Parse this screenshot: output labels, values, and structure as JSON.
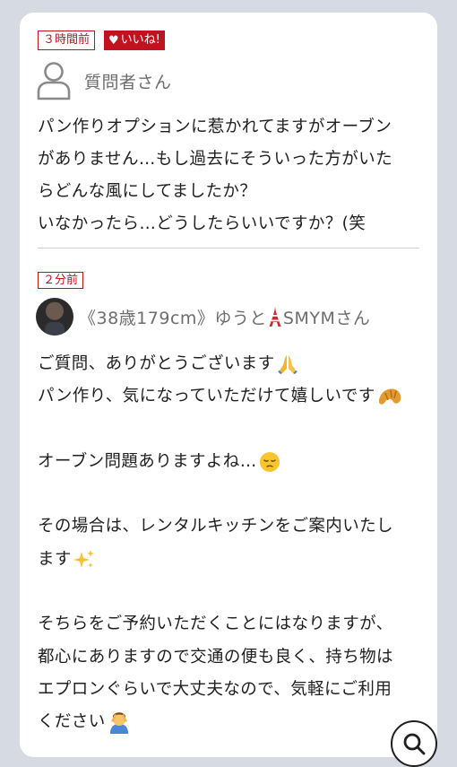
{
  "question": {
    "time_badge": "３時間前",
    "like_badge": "いいね!",
    "username": "質問者さん",
    "text": "パン作りオプションに惹かれてますがオーブン\nがありません…もし過去にそういった方がいた\nらどんな風にしてましたか？\nいなかったら…どうしたらいいですか？(笑"
  },
  "answer": {
    "time_badge": "２分前",
    "username_before": "《38歳179cm》ゆうと",
    "username_after": "SMYMさん",
    "lines": [
      "ご質問、ありがとうございます",
      "パン作り、気になっていただけて嬉しいです",
      "",
      "オーブン問題ありますよね…",
      "",
      "その場合は、レンタルキッチンをご案内いたし",
      "ます",
      "",
      "そちらをご予約いただくことにはなりますが、",
      "都心にありますので交通の便も良く、持ち物は",
      "エプロンぐらいで大丈夫なので、気軽にご利用",
      "ください"
    ]
  },
  "icons": {
    "question_avatar": "person-outline-icon",
    "tower": "tokyo-tower-icon",
    "pray": "folded-hands-emoji",
    "croissant": "croissant-emoji",
    "pensive": "pensive-face-emoji",
    "sparkles": "sparkles-emoji",
    "bowing": "person-bowing-emoji",
    "search": "search-icon"
  },
  "colors": {
    "accent": "#c1121f",
    "background": "#d6dae3",
    "card": "#ffffff"
  }
}
